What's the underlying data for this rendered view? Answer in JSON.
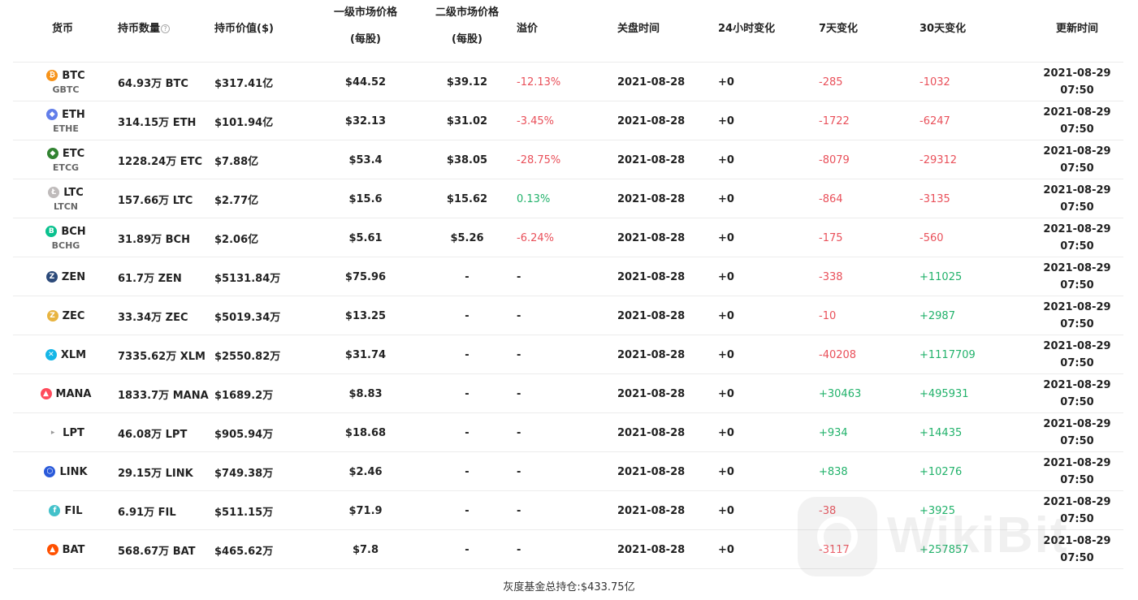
{
  "header": {
    "coin": "货币",
    "qty": "持币数量",
    "qty_help": "?",
    "value": "持币价值($)",
    "primary_price": "一级市场价格",
    "primary_unit": "(每股)",
    "secondary_price": "二级市场价格",
    "secondary_unit": "(每股)",
    "premium": "溢价",
    "close_time": "关盘时间",
    "change_24h": "24小时变化",
    "change_7d": "7天变化",
    "change_30d": "30天变化",
    "update_time": "更新时间"
  },
  "rows": [
    {
      "symbol": "BTC",
      "trust": "GBTC",
      "icon": "btc-icon",
      "icon_color": "#f7931a",
      "glyph": "₿",
      "qty": "64.93万 BTC",
      "value": "$317.41亿",
      "primary": "$44.52",
      "secondary": "$39.12",
      "premium": "-12.13%",
      "premium_sign": "neg",
      "date": "2021-08-28",
      "d24": "+0",
      "d7": "-285",
      "d7_sign": "neg",
      "d30": "-1032",
      "d30_sign": "neg",
      "upd_date": "2021-08-29",
      "upd_time": "07:50"
    },
    {
      "symbol": "ETH",
      "trust": "ETHE",
      "icon": "eth-icon",
      "icon_color": "#627eea",
      "glyph": "◆",
      "qty": "314.15万 ETH",
      "value": "$101.94亿",
      "primary": "$32.13",
      "secondary": "$31.02",
      "premium": "-3.45%",
      "premium_sign": "neg",
      "date": "2021-08-28",
      "d24": "+0",
      "d7": "-1722",
      "d7_sign": "neg",
      "d30": "-6247",
      "d30_sign": "neg",
      "upd_date": "2021-08-29",
      "upd_time": "07:50"
    },
    {
      "symbol": "ETC",
      "trust": "ETCG",
      "icon": "etc-icon",
      "icon_color": "#328332",
      "glyph": "◆",
      "qty": "1228.24万 ETC",
      "value": "$7.88亿",
      "primary": "$53.4",
      "secondary": "$38.05",
      "premium": "-28.75%",
      "premium_sign": "neg",
      "date": "2021-08-28",
      "d24": "+0",
      "d7": "-8079",
      "d7_sign": "neg",
      "d30": "-29312",
      "d30_sign": "neg",
      "upd_date": "2021-08-29",
      "upd_time": "07:50"
    },
    {
      "symbol": "LTC",
      "trust": "LTCN",
      "icon": "ltc-icon",
      "icon_color": "#bfbbbb",
      "glyph": "Ł",
      "qty": "157.66万 LTC",
      "value": "$2.77亿",
      "primary": "$15.6",
      "secondary": "$15.62",
      "premium": "0.13%",
      "premium_sign": "pos",
      "date": "2021-08-28",
      "d24": "+0",
      "d7": "-864",
      "d7_sign": "neg",
      "d30": "-3135",
      "d30_sign": "neg",
      "upd_date": "2021-08-29",
      "upd_time": "07:50"
    },
    {
      "symbol": "BCH",
      "trust": "BCHG",
      "icon": "bch-icon",
      "icon_color": "#0ac18e",
      "glyph": "B",
      "qty": "31.89万 BCH",
      "value": "$2.06亿",
      "primary": "$5.61",
      "secondary": "$5.26",
      "premium": "-6.24%",
      "premium_sign": "neg",
      "date": "2021-08-28",
      "d24": "+0",
      "d7": "-175",
      "d7_sign": "neg",
      "d30": "-560",
      "d30_sign": "neg",
      "upd_date": "2021-08-29",
      "upd_time": "07:50"
    },
    {
      "symbol": "ZEN",
      "trust": "",
      "icon": "zen-icon",
      "icon_color": "#2c4a7a",
      "glyph": "Z",
      "qty": "61.7万 ZEN",
      "value": "$5131.84万",
      "primary": "$75.96",
      "secondary": "-",
      "premium": "-",
      "premium_sign": "",
      "date": "2021-08-28",
      "d24": "+0",
      "d7": "-338",
      "d7_sign": "neg",
      "d30": "+11025",
      "d30_sign": "pos",
      "upd_date": "2021-08-29",
      "upd_time": "07:50"
    },
    {
      "symbol": "ZEC",
      "trust": "",
      "icon": "zec-icon",
      "icon_color": "#e8b440",
      "glyph": "Z",
      "qty": "33.34万 ZEC",
      "value": "$5019.34万",
      "primary": "$13.25",
      "secondary": "-",
      "premium": "-",
      "premium_sign": "",
      "date": "2021-08-28",
      "d24": "+0",
      "d7": "-10",
      "d7_sign": "neg",
      "d30": "+2987",
      "d30_sign": "pos",
      "upd_date": "2021-08-29",
      "upd_time": "07:50"
    },
    {
      "symbol": "XLM",
      "trust": "",
      "icon": "xlm-icon",
      "icon_color": "#14b6e7",
      "glyph": "✕",
      "qty": "7335.62万 XLM",
      "value": "$2550.82万",
      "primary": "$31.74",
      "secondary": "-",
      "premium": "-",
      "premium_sign": "",
      "date": "2021-08-28",
      "d24": "+0",
      "d7": "-40208",
      "d7_sign": "neg",
      "d30": "+1117709",
      "d30_sign": "pos",
      "upd_date": "2021-08-29",
      "upd_time": "07:50"
    },
    {
      "symbol": "MANA",
      "trust": "",
      "icon": "mana-icon",
      "icon_color": "#ff4b5c",
      "glyph": "▲",
      "qty": "1833.7万 MANA",
      "value": "$1689.2万",
      "primary": "$8.83",
      "secondary": "-",
      "premium": "-",
      "premium_sign": "",
      "date": "2021-08-28",
      "d24": "+0",
      "d7": "+30463",
      "d7_sign": "pos",
      "d30": "+495931",
      "d30_sign": "pos",
      "upd_date": "2021-08-29",
      "upd_time": "07:50"
    },
    {
      "symbol": "LPT",
      "trust": "",
      "icon": "lpt-icon",
      "icon_color": "#ffffff",
      "glyph": "▸",
      "qty": "46.08万 LPT",
      "value": "$905.94万",
      "primary": "$18.68",
      "secondary": "-",
      "premium": "-",
      "premium_sign": "",
      "date": "2021-08-28",
      "d24": "+0",
      "d7": "+934",
      "d7_sign": "pos",
      "d30": "+14435",
      "d30_sign": "pos",
      "upd_date": "2021-08-29",
      "upd_time": "07:50"
    },
    {
      "symbol": "LINK",
      "trust": "",
      "icon": "link-icon",
      "icon_color": "#2a5ada",
      "glyph": "⬡",
      "qty": "29.15万 LINK",
      "value": "$749.38万",
      "primary": "$2.46",
      "secondary": "-",
      "premium": "-",
      "premium_sign": "",
      "date": "2021-08-28",
      "d24": "+0",
      "d7": "+838",
      "d7_sign": "pos",
      "d30": "+10276",
      "d30_sign": "pos",
      "upd_date": "2021-08-29",
      "upd_time": "07:50"
    },
    {
      "symbol": "FIL",
      "trust": "",
      "icon": "fil-icon",
      "icon_color": "#42c1ca",
      "glyph": "f",
      "qty": "6.91万 FIL",
      "value": "$511.15万",
      "primary": "$71.9",
      "secondary": "-",
      "premium": "-",
      "premium_sign": "",
      "date": "2021-08-28",
      "d24": "+0",
      "d7": "-38",
      "d7_sign": "neg",
      "d30": "+3925",
      "d30_sign": "pos",
      "upd_date": "2021-08-29",
      "upd_time": "07:50"
    },
    {
      "symbol": "BAT",
      "trust": "",
      "icon": "bat-icon",
      "icon_color": "#ff5000",
      "glyph": "▲",
      "qty": "568.67万 BAT",
      "value": "$465.62万",
      "primary": "$7.8",
      "secondary": "-",
      "premium": "-",
      "premium_sign": "",
      "date": "2021-08-28",
      "d24": "+0",
      "d7": "-3117",
      "d7_sign": "neg",
      "d30": "+257857",
      "d30_sign": "pos",
      "upd_date": "2021-08-29",
      "upd_time": "07:50"
    }
  ],
  "footer": {
    "total_label": "灰度基金总持仓:",
    "total_value": "$433.75亿"
  },
  "watermark": {
    "text": "WikiBit"
  }
}
